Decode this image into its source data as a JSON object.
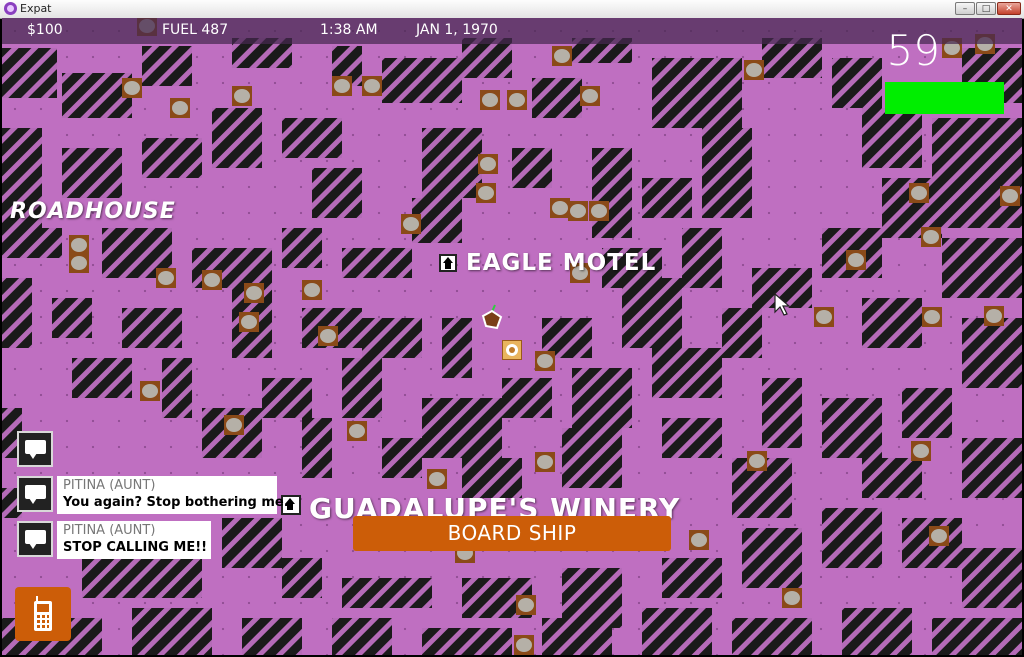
{
  "window": {
    "title": "Expat"
  },
  "hud": {
    "money": "$100",
    "fuel": "FUEL 487",
    "time": "1:38 AM",
    "date": "JAN 1, 1970",
    "countdown": "59",
    "health_fraction": 1.0
  },
  "map": {
    "places": {
      "roadhouse": "ROADHOUSE",
      "motel": "EAGLE MOTEL",
      "winery": "GUADALUPE'S WINERY"
    },
    "colors": {
      "ground": "#bf6fc1",
      "wall_dark": "#1a1a1a",
      "wall_stripe": "#b56bb8",
      "item_fill": "#b5b0a7",
      "item_border": "#8a4a18",
      "accent_orange": "#cc5d08",
      "health_green": "#00ee00"
    }
  },
  "messages": [
    {
      "sender": "PITINA (AUNT)",
      "text": "You again? Stop bothering me."
    },
    {
      "sender": "PITINA (AUNT)",
      "text": "STOP CALLING ME!!"
    }
  ],
  "actions": {
    "board_ship": "BOARD SHIP"
  },
  "icons": {
    "app": "expat-app-icon",
    "place_marker": "house-icon",
    "chat": "chat-bubble-icon",
    "phone": "cellphone-icon",
    "player": "player-ship-icon",
    "target": "target-marker-icon",
    "cursor": "mouse-cursor-icon"
  }
}
